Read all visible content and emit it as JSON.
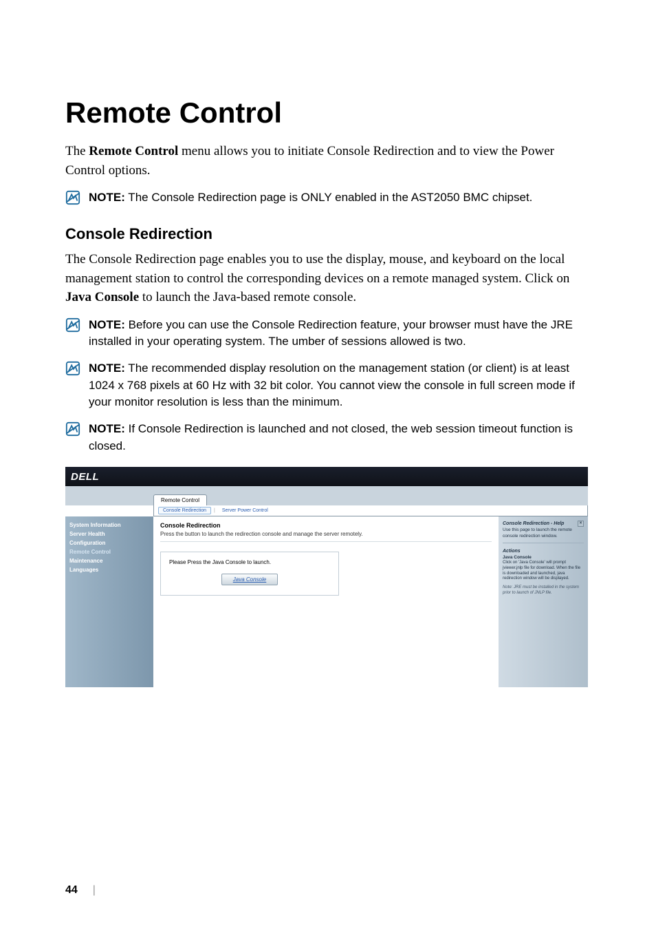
{
  "title": "Remote Control",
  "intro_pre": "The ",
  "intro_bold": "Remote Control",
  "intro_post": " menu allows you to initiate Console Redirection and to view the Power Control options.",
  "note1": {
    "label": "NOTE:",
    "text": " The Console Redirection page is ONLY enabled in the AST2050 BMC chipset."
  },
  "subhead": "Console Redirection",
  "body_pre": "The Console Redirection page enables you to use the display, mouse, and keyboard on the local management station to control the corresponding devices on a remote managed system. Click on ",
  "body_bold": "Java Console",
  "body_post": " to launch the Java-based remote console.",
  "note2": {
    "label": "NOTE:",
    "text": " Before you can use the Console Redirection feature, your browser must have the JRE installed in your operating system. The umber of sessions allowed is two."
  },
  "note3": {
    "label": "NOTE:",
    "text": " The recommended display resolution on the management station (or client) is at least 1024 x 768 pixels at 60 Hz with 32 bit color. You cannot view the console in full screen mode if your monitor resolution is less than the minimum."
  },
  "note4": {
    "label": "NOTE:",
    "text": " If Console Redirection is launched and not closed, the web session timeout function is closed."
  },
  "ss": {
    "logo": "DELL",
    "tab_active": "Remote Control",
    "subtab_active": "Console Redirection",
    "subtab_other": "Server Power Control",
    "sidebar": [
      "System Information",
      "Server Health",
      "Configuration",
      "Remote Control",
      "Maintenance",
      "Languages"
    ],
    "main_title": "Console Redirection",
    "main_sub": "Press the button to launch the redirection console and manage the server remotely.",
    "panel_text": "Please Press the Java Console to launch.",
    "button": "Java Console",
    "help_title": "Console Redirection - Help",
    "help_desc": "Use this page to launch the remote console redirection window.",
    "help_section": "Actions",
    "help_item": "Java Console",
    "help_body": "Click on 'Java Console' will prompt jviewer.jnlp file for download. When the file is downloaded and launched, java redirection window will be displayed.",
    "help_note": "Note: JRE must be installed in the system prior to launch of JNLP file."
  },
  "page": "44"
}
